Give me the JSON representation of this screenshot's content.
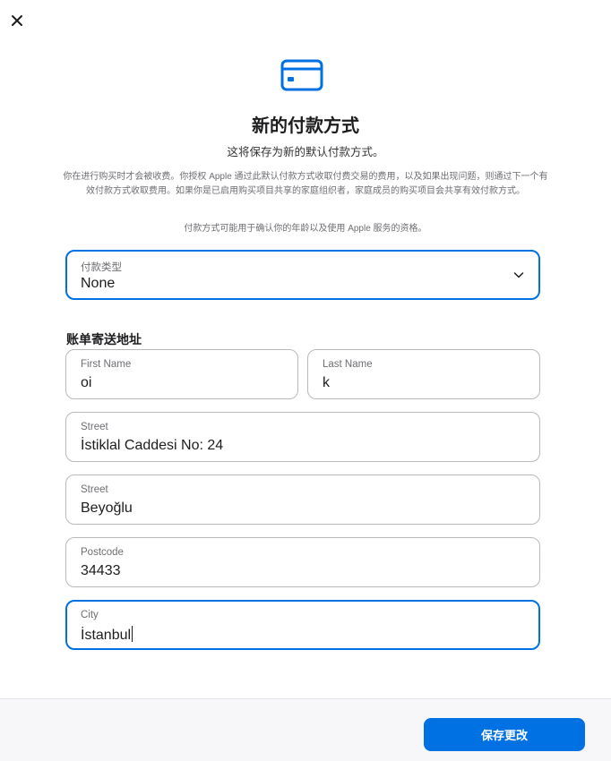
{
  "header": {
    "title": "新的付款方式",
    "subtitle": "这将保存为新的默认付款方式。",
    "notice": "你在进行购买时才会被收费。你授权 Apple 通过此默认付款方式收取付费交易的费用，以及如果出现问题，则通过下一个有效付款方式收取费用。如果你是已启用购买项目共享的家庭组织者，家庭成员的购买项目会共享有效付款方式。",
    "notice2": "付款方式可能用于确认你的年龄以及使用 Apple 服务的资格。"
  },
  "payment_type": {
    "label": "付款类型",
    "value": "None"
  },
  "billing": {
    "section_title": "账单寄送地址",
    "first_name": {
      "label": "First Name",
      "value": "oi"
    },
    "last_name": {
      "label": "Last Name",
      "value": "k"
    },
    "street1": {
      "label": "Street",
      "value": "İstiklal Caddesi No: 24"
    },
    "street2": {
      "label": "Street",
      "value": "Beyoğlu"
    },
    "postcode": {
      "label": "Postcode",
      "value": "34433"
    },
    "city": {
      "label": "City",
      "value": "İstanbul"
    }
  },
  "footer": {
    "save_label": "保存更改"
  },
  "colors": {
    "accent": "#0071e3",
    "border": "#b9b9bd"
  },
  "icons": {
    "close": "close-icon",
    "card": "credit-card-icon",
    "chevron": "chevron-down-icon"
  }
}
